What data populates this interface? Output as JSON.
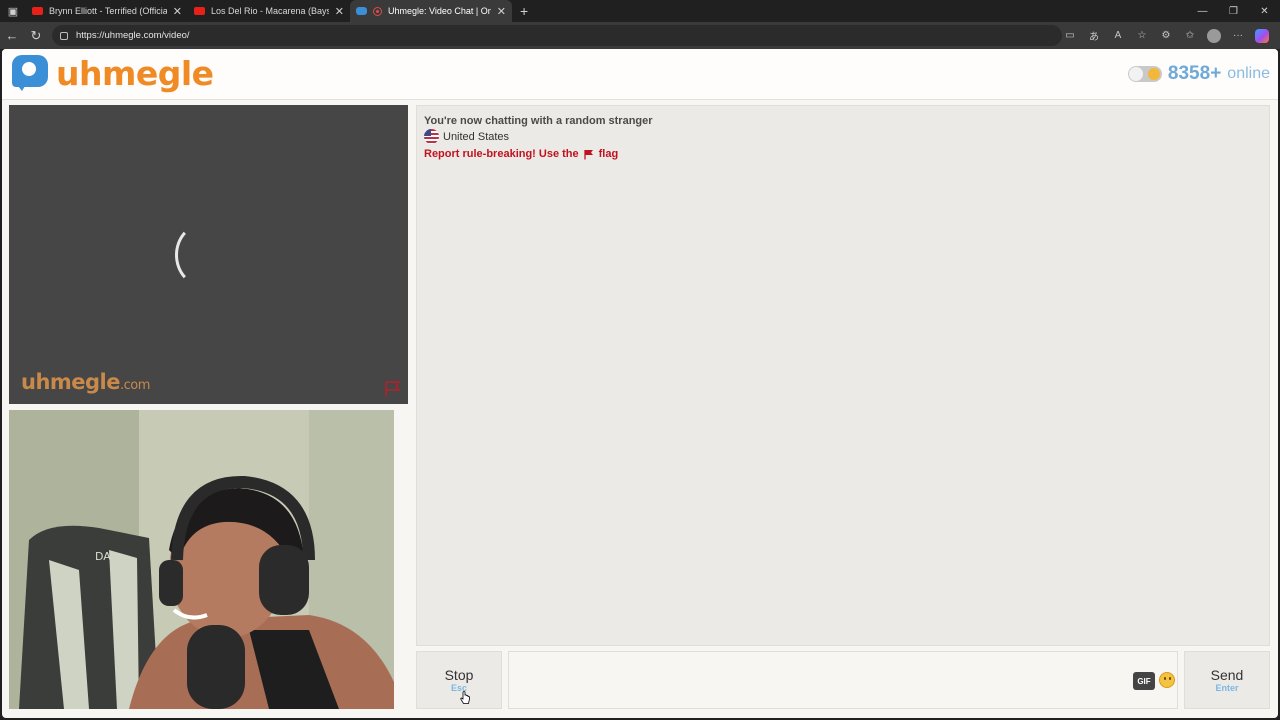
{
  "browser": {
    "tabs": [
      {
        "title": "Brynn Elliott - Terrified (Official Vi",
        "favicon": "youtube-icon",
        "active": false
      },
      {
        "title": "Los Del Rio - Macarena (Bayside B",
        "favicon": "youtube-icon",
        "active": false
      },
      {
        "title": "Uhmegle: Video Chat | Ome",
        "favicon": "uhmegle-icon",
        "active": true,
        "recording": true
      }
    ],
    "new_tab": "+",
    "url": "https://uhmegle.com/video/"
  },
  "header": {
    "logo_text": "uhmegle",
    "online_count": "8358+",
    "online_label": "online",
    "colors": {
      "brand_orange": "#f08a24",
      "brand_blue": "#3b8fd6"
    }
  },
  "remote_video": {
    "watermark": "uhmegle",
    "watermark_domain": ".com",
    "state": "loading"
  },
  "chat": {
    "status": "You're now chatting with a random stranger",
    "country": "United States",
    "report_text_before": "Report rule-breaking! Use the",
    "report_text_after": "flag",
    "report_color": "#c1121f"
  },
  "controls": {
    "stop_label": "Stop",
    "stop_key": "Esc",
    "gif_label": "GIF",
    "send_label": "Send",
    "send_key": "Enter",
    "key_color": "#7ab8e3"
  }
}
